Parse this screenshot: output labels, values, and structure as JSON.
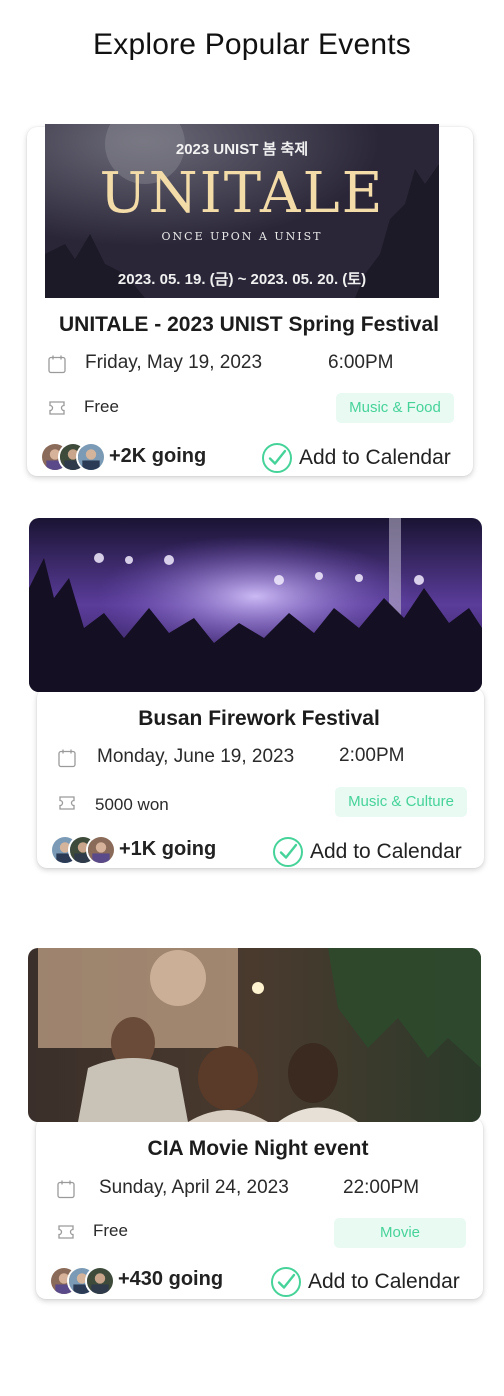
{
  "header": {
    "title": "Explore Popular Events"
  },
  "events": [
    {
      "banner": {
        "top_line": "2023 UNIST 봄 축제",
        "logo": "UNITALE",
        "tagline": "ONCE UPON A UNIST",
        "dates": "2023. 05. 19. (금) ~ 2023. 05. 20. (토)"
      },
      "title": "UNITALE - 2023 UNIST Spring Festival",
      "date": "Friday, May 19, 2023",
      "time": "6:00PM",
      "price": "Free",
      "tag": "Music & Food",
      "going": "+2K going",
      "add_label": "Add to Calendar"
    },
    {
      "title": "Busan Firework Festival",
      "date": "Monday, June 19, 2023",
      "time": "2:00PM",
      "price": "5000 won",
      "tag": "Music & Culture",
      "going": "+1K going",
      "add_label": "Add to Calendar"
    },
    {
      "title": "CIA Movie Night event",
      "date": "Sunday, April 24, 2023",
      "time": "22:00PM",
      "price": "Free",
      "tag": "Movie",
      "going": "+430 going",
      "add_label": "Add to Calendar"
    }
  ],
  "colors": {
    "tag_text": "#46d39a",
    "tag_bg": "#e9faf3",
    "check": "#46d39a"
  },
  "icons": {
    "date": "calendar-icon",
    "price": "ticket-icon",
    "add": "check-circle-icon"
  }
}
